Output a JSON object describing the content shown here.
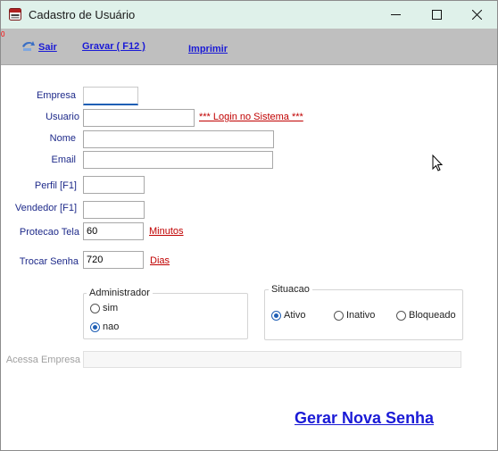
{
  "window": {
    "title": "Cadastro de Usuário",
    "icon": "app-window-icon",
    "titlebar_color": "#dff1ea"
  },
  "toolbar": {
    "sair_label": "Sair",
    "gravar_label": "Gravar ( F12 )",
    "imprimir_label": "Imprimir",
    "marker": "0"
  },
  "form": {
    "empresa_label": "Empresa",
    "empresa_value": "",
    "usuario_label": "Usuario",
    "usuario_value": "",
    "login_hint": "*** Login no Sistema ***",
    "nome_label": "Nome",
    "nome_value": "",
    "email_label": "Email",
    "email_value": "",
    "perfil_label": "Perfil [F1]",
    "perfil_value": "",
    "vendedor_label": "Vendedor [F1]",
    "vendedor_value": "",
    "protecao_label": "Protecao Tela",
    "protecao_value": "60",
    "protecao_unit": "Minutos",
    "trocar_label": "Trocar Senha",
    "trocar_value": "720",
    "trocar_unit": "Dias",
    "acessa_label": "Acessa Empresa",
    "acessa_value": ""
  },
  "administrador": {
    "title": "Administrador",
    "options": [
      "sim",
      "nao"
    ],
    "selected": "nao"
  },
  "situacao": {
    "title": "Situacao",
    "options": [
      "Ativo",
      "Inativo",
      "Bloqueado"
    ],
    "selected": "Ativo"
  },
  "actions": {
    "gerar_label": "Gerar Nova Senha"
  },
  "colors": {
    "link_blue": "#1a1ad6",
    "label_blue": "#1e2a8a",
    "link_red": "#c00000",
    "accent": "#1f5fb5"
  }
}
